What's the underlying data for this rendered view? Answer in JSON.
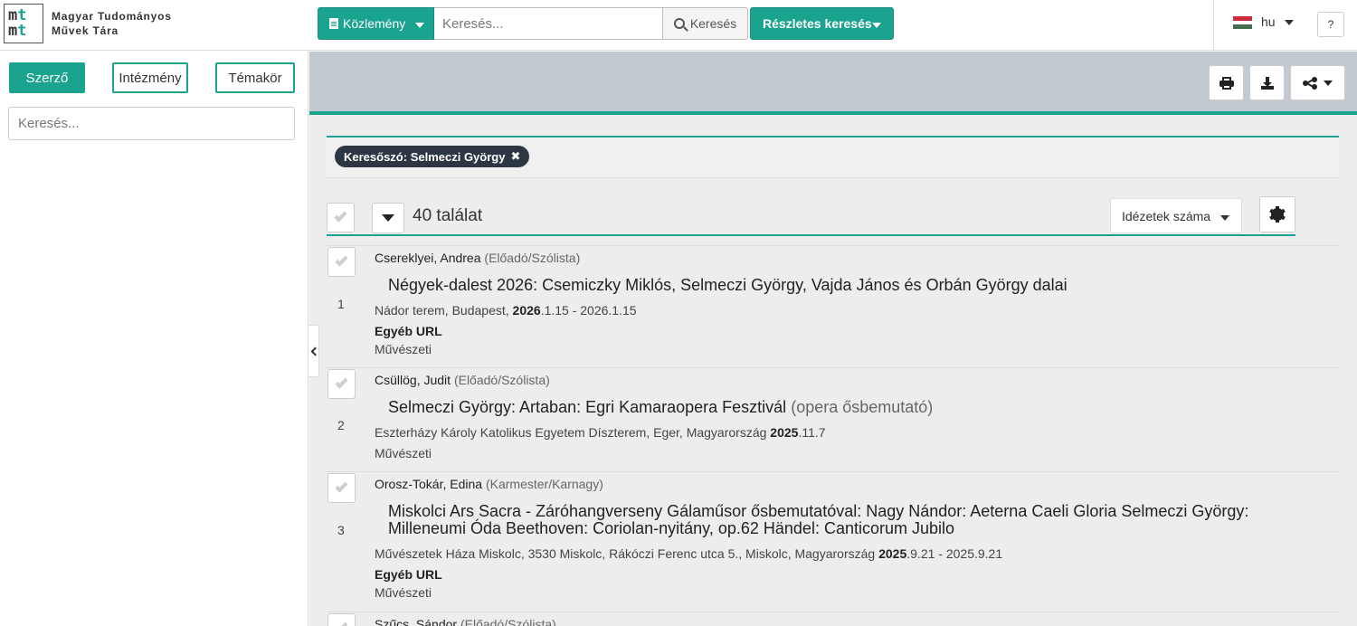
{
  "header": {
    "logo_letters": [
      "m",
      "t",
      "m",
      "t"
    ],
    "site_title_line1": "Magyar Tudományos",
    "site_title_line2": "Művek Tára",
    "type_button_label": "Közlemény",
    "search_placeholder": "Keresés...",
    "search_button_label": "Keresés",
    "advanced_search_label": "Részletes keresés",
    "language": "hu",
    "help_label": "?"
  },
  "colors": {
    "accent": "#1aa38f",
    "chip_bg": "#2d3744",
    "band": "#c3c9d1",
    "flag": [
      "#cd2a3e",
      "#ffffff",
      "#436f4d"
    ]
  },
  "sidebar": {
    "tabs": [
      {
        "label": "Szerző",
        "active": true
      },
      {
        "label": "Intézmény",
        "active": false
      },
      {
        "label": "Témakör",
        "active": false
      }
    ],
    "search_placeholder": "Keresés..."
  },
  "toolbar": {
    "icons": [
      "print-icon",
      "download-icon",
      "share-icon"
    ]
  },
  "filter": {
    "chip_label": "Keresőszó: Selmeczi György",
    "chip_close": "✖"
  },
  "results": {
    "count_label": "40 találat",
    "sort_label": "Idézetek száma",
    "items": [
      {
        "num": "1",
        "author": "Cserekly­ei, Andrea",
        "role": "(Előadó/Szólista)",
        "title": "Négyek-dalest 2026: Csemiczky Miklós, Selmeczi György, Vajda János és Orbán György dalai",
        "title_sub": "",
        "meta_prefix": "Nádor terem, Budapest,",
        "meta_bold": "2026",
        "meta_suffix": ".1.15 - 2026.1.15",
        "url_label": "Egyéb URL",
        "category": "Művészeti"
      },
      {
        "num": "2",
        "author": "Csüllög, Judit",
        "role": "(Előadó/Szólista)",
        "title": "Selmeczi György: Artaban: Egri Kamaraopera Fesztivál",
        "title_sub": "(opera ősbemutató)",
        "meta_prefix": "Eszterházy Károly Katolikus Egyetem Díszterem, Eger, Magyarország",
        "meta_bold": "2025",
        "meta_suffix": ".11.7",
        "url_label": "",
        "category": "Művészeti"
      },
      {
        "num": "3",
        "author": "Orosz-Tokár, Edina",
        "role": "(Karmester/Karnagy)",
        "title": "Miskolci Ars Sacra - Záróhangverseny Gálaműsor ősbemutatóval: Nagy Nándor: Aeterna Caeli Gloria Selmeczi György: Milleneumi Óda Beethoven: Coriolan-nyitány, op.62 Händel: Canticorum Jubilo",
        "title_sub": "",
        "meta_prefix": "Művészetek Háza Miskolc, 3530 Miskolc, Rákóczi Ferenc utca 5., Miskolc, Magyarország",
        "meta_bold": "2025",
        "meta_suffix": ".9.21 - 2025.9.21",
        "url_label": "Egyéb URL",
        "category": "Művészeti"
      },
      {
        "num": "",
        "author": "Szűcs, Sándor",
        "role": "(Előadó/Szólista)",
        "title": "",
        "title_sub": "",
        "meta_prefix": "",
        "meta_bold": "",
        "meta_suffix": "",
        "url_label": "",
        "category": ""
      }
    ]
  }
}
